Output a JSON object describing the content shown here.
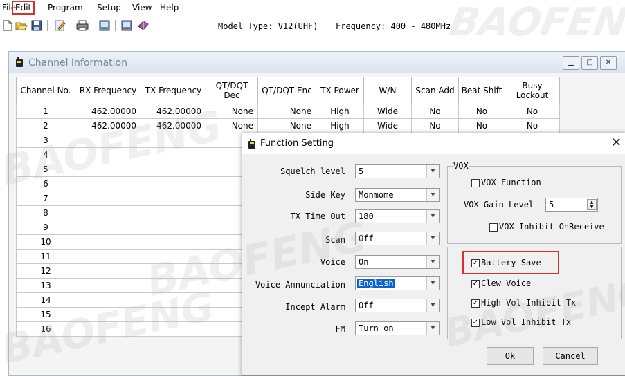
{
  "menu": [
    "File",
    "Edit",
    "Program",
    "Setup",
    "View",
    "Help"
  ],
  "toolbar": {
    "icons": [
      "new-file-icon",
      "open-folder-icon",
      "save-icon",
      "edit-icon",
      "print-icon",
      "read-radio-icon",
      "write-radio-icon",
      "book-icon"
    ],
    "model_type": "Model Type: V12(UHF)",
    "frequency": "Frequency: 400 - 480MHz"
  },
  "channel_window": {
    "title": "Channel Information",
    "columns": [
      "Channel No.",
      "RX Frequency",
      "TX Frequency",
      "QT/DQT Dec",
      "QT/DQT Enc",
      "TX Power",
      "W/N",
      "Scan Add",
      "Beat Shift",
      "Busy Lockout"
    ],
    "rows": [
      [
        "1",
        "462.00000",
        "462.00000",
        "None",
        "None",
        "High",
        "Wide",
        "No",
        "No",
        "No"
      ],
      [
        "2",
        "462.00000",
        "462.00000",
        "None",
        "None",
        "High",
        "Wide",
        "No",
        "No",
        "No"
      ],
      [
        "3"
      ],
      [
        "4"
      ],
      [
        "5"
      ],
      [
        "6"
      ],
      [
        "7"
      ],
      [
        "8"
      ],
      [
        "9"
      ],
      [
        "10"
      ],
      [
        "11"
      ],
      [
        "12"
      ],
      [
        "13"
      ],
      [
        "14"
      ],
      [
        "15"
      ],
      [
        "16"
      ]
    ]
  },
  "dialog": {
    "title": "Function Setting",
    "fields": [
      {
        "label": "Squelch level",
        "value": "5"
      },
      {
        "label": "Side Key",
        "value": "Monmome"
      },
      {
        "label": "TX Time Out",
        "value": "180"
      },
      {
        "label": "Scan",
        "value": "Off"
      },
      {
        "label": "Voice",
        "value": "On"
      },
      {
        "label": "Voice Annunciation",
        "value": "English"
      },
      {
        "label": "Incept Alarm",
        "value": "Off"
      },
      {
        "label": "FM",
        "value": "Turn on"
      }
    ],
    "vox": {
      "group_label": "VOX",
      "function_label": "VOX Function",
      "function_checked": false,
      "gain_label": "VOX Gain Level",
      "gain_value": "5",
      "inhibit_label": "VOX Inhibit OnReceive",
      "inhibit_checked": false
    },
    "options": [
      {
        "label": "Battery Save",
        "checked": true
      },
      {
        "label": "Clew Voice",
        "checked": true
      },
      {
        "label": "High Vol Inhibit Tx",
        "checked": true
      },
      {
        "label": "Low Vol Inhibit Tx",
        "checked": true
      }
    ],
    "ok_label": "Ok",
    "cancel_label": "Cancel"
  },
  "watermark": "BAOFENG",
  "colors": {
    "highlight": "#d9302b",
    "selection": "#0b63d1"
  }
}
